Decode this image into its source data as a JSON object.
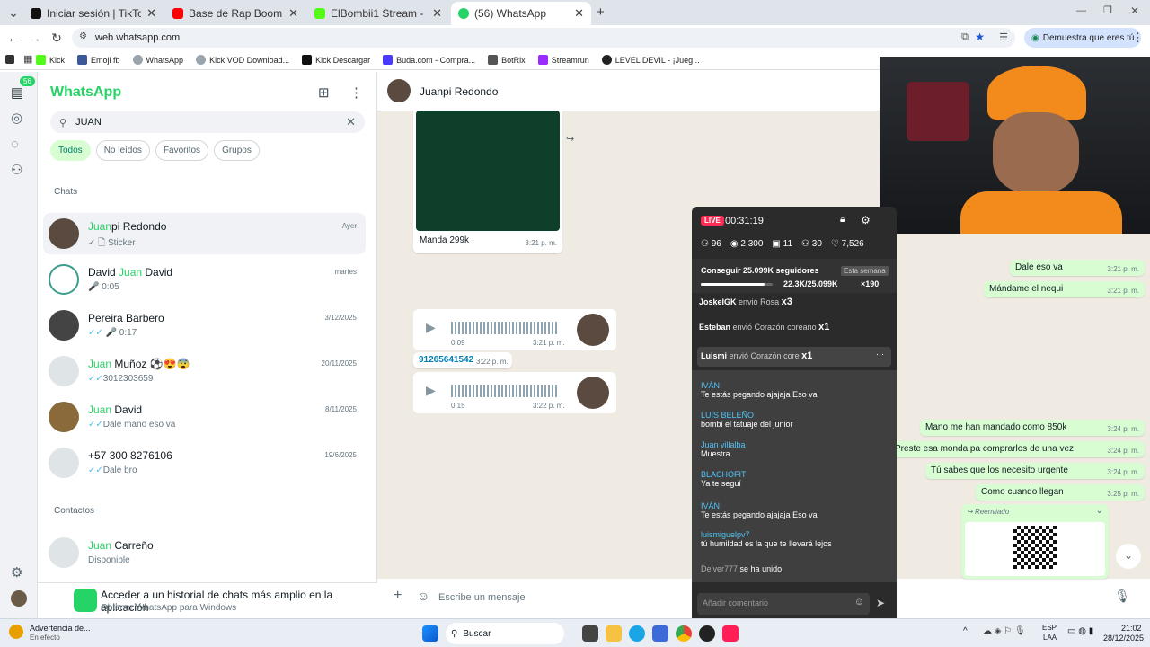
{
  "browser": {
    "tabs": [
      {
        "title": "Iniciar sesión | TikTok",
        "icon": "tiktok-icon",
        "color": "#111111"
      },
      {
        "title": "Base de Rap Boom Bap Con",
        "icon": "youtube-icon",
        "color": "#ff0000"
      },
      {
        "title": "ElBombii1 Stream - Watch Live",
        "icon": "kick-icon",
        "color": "#53fc18"
      },
      {
        "title": "(56) WhatsApp",
        "icon": "whatsapp-icon",
        "color": "#25d366"
      }
    ],
    "url": "web.whatsapp.com",
    "profile_pill": "Demuestra que eres tú",
    "bookmarks": [
      {
        "label": "Kick",
        "color": "#53fc18"
      },
      {
        "label": "Emoji fb",
        "color": "#3b5998"
      },
      {
        "label": "WhatsApp",
        "color": "#25d366"
      },
      {
        "label": "Kick VOD Download...",
        "color": "#888888"
      },
      {
        "label": "Kick Descargar",
        "color": "#111111"
      },
      {
        "label": "Buda.com - Compra...",
        "color": "#4a3aff"
      },
      {
        "label": "BotRix",
        "color": "#555555"
      },
      {
        "label": "Streamrun",
        "color": "#9b2cff"
      },
      {
        "label": "LEVEL DEVIL - ¡Jueg...",
        "color": "#222222"
      }
    ]
  },
  "whatsapp": {
    "badge": "56",
    "brand": "WhatsApp",
    "search_value": "JUAN",
    "filters": [
      "Todos",
      "No leídos",
      "Favoritos",
      "Grupos"
    ],
    "section_chats": "Chats",
    "section_contacts": "Contactos",
    "chats": [
      {
        "hl": "Juan",
        "rest": "pi Redondo",
        "tick": "✓",
        "preview": "🗋 Sticker",
        "date": "Ayer",
        "avatar": "#5a4a3f"
      },
      {
        "hl": "Juan",
        "prefix": "David ",
        "rest": " David",
        "tick": "",
        "preview": "🎤 0:05",
        "date": "martes",
        "avatar": "#3b9e8c"
      },
      {
        "hl": "",
        "prefix": "Pereira Barbero",
        "rest": "",
        "tick": "✓✓",
        "preview": "🎤 0:17",
        "date": "3/12/2025",
        "avatar": "#444444"
      },
      {
        "hl": "Juan",
        "rest": " Muñoz ⚽😍😨",
        "tick": "✓✓",
        "preview": "3012303659",
        "date": "20/11/2025",
        "avatar": "#dfe5e7"
      },
      {
        "hl": "Juan",
        "rest": " David",
        "tick": "✓✓",
        "preview": "Dale mano eso va",
        "date": "8/11/2025",
        "avatar": "#8a6a3a"
      },
      {
        "hl": "",
        "prefix": "+57 300 8276106",
        "rest": "",
        "tick": "✓✓",
        "preview": "Dale bro",
        "date": "19/6/2025",
        "avatar": "#dfe5e7"
      }
    ],
    "contacts": [
      {
        "hl": "Juan",
        "rest": " Carreño",
        "preview": "Disponible"
      }
    ],
    "footer_title": "Acceder a un historial de chats más amplio en la aplicación",
    "footer_sub": "Obtener WhatsApp para Windows",
    "conversation": {
      "name": "Juanpi Redondo",
      "image_caption": "Manda 299k",
      "image_time": "3:21 p. m.",
      "voice1": {
        "dur": "0:09",
        "time": "3:21 p. m."
      },
      "number_msg": "91265641542",
      "number_time": "3:22 p. m.",
      "voice2": {
        "dur": "0:15",
        "time": "3:22 p. m."
      },
      "outgoing": [
        {
          "text": "Dale eso va",
          "time": "3:21 p. m."
        },
        {
          "text": "Mándame el nequi",
          "time": "3:21 p. m."
        },
        {
          "text": "Mano me han mandado como 850k",
          "time": "3:24 p. m."
        },
        {
          "text": "Preste esa monda pa comprarlos de una vez",
          "time": "3:24 p. m."
        },
        {
          "text": "Tú sabes que los necesito urgente",
          "time": "3:24 p. m."
        },
        {
          "text": "Como cuando llegan",
          "time": "3:25 p. m."
        }
      ],
      "forwarded": "Reenviado",
      "compose_placeholder": "Escribe un mensaje"
    }
  },
  "stream_overlay": {
    "live": "LIVE",
    "timer": "00:31:19",
    "stats": [
      "96",
      "2,300",
      "11",
      "30",
      "7,526"
    ],
    "goal_title": "Conseguir 25.099K seguidores",
    "goal_tag": "Esta semana",
    "goal_progress": "22.3K/25.099K",
    "goal_fraction": 0.89,
    "goal_multiplier": "×190",
    "gifts": [
      {
        "user": "JoskelGK",
        "text": "envió Rosa",
        "count": "x3"
      },
      {
        "user": "Esteban",
        "text": "envió Corazón coreano",
        "count": "x1"
      },
      {
        "user": "Luismi",
        "text": "envió Corazón core",
        "count": "x1"
      }
    ],
    "comments": [
      {
        "user": "IVÁN",
        "text": "Te estás pegando ajajaja Eso va"
      },
      {
        "user": "LUIS BELEÑO",
        "text": "bombi el tatuaje del junior"
      },
      {
        "user": "Juan villalba",
        "text": "Muestra"
      },
      {
        "user": "BLACHOFIT",
        "text": "Ya te seguí"
      },
      {
        "user": "IVÁN",
        "text": "Te estás pegando ajajaja Eso va"
      },
      {
        "user": "luismiguelpv7",
        "text": "tú humildad es la que te llevará lejos"
      },
      {
        "user": "Delver777",
        "text": "se ha unido"
      }
    ],
    "comment_placeholder": "Añadir comentario"
  },
  "taskbar": {
    "weather_title": "Advertencia de...",
    "weather_sub": "En efecto",
    "search": "Buscar",
    "lang": "ESP",
    "lang2": "LAA",
    "time": "21:02",
    "date": "28/12/2025"
  }
}
